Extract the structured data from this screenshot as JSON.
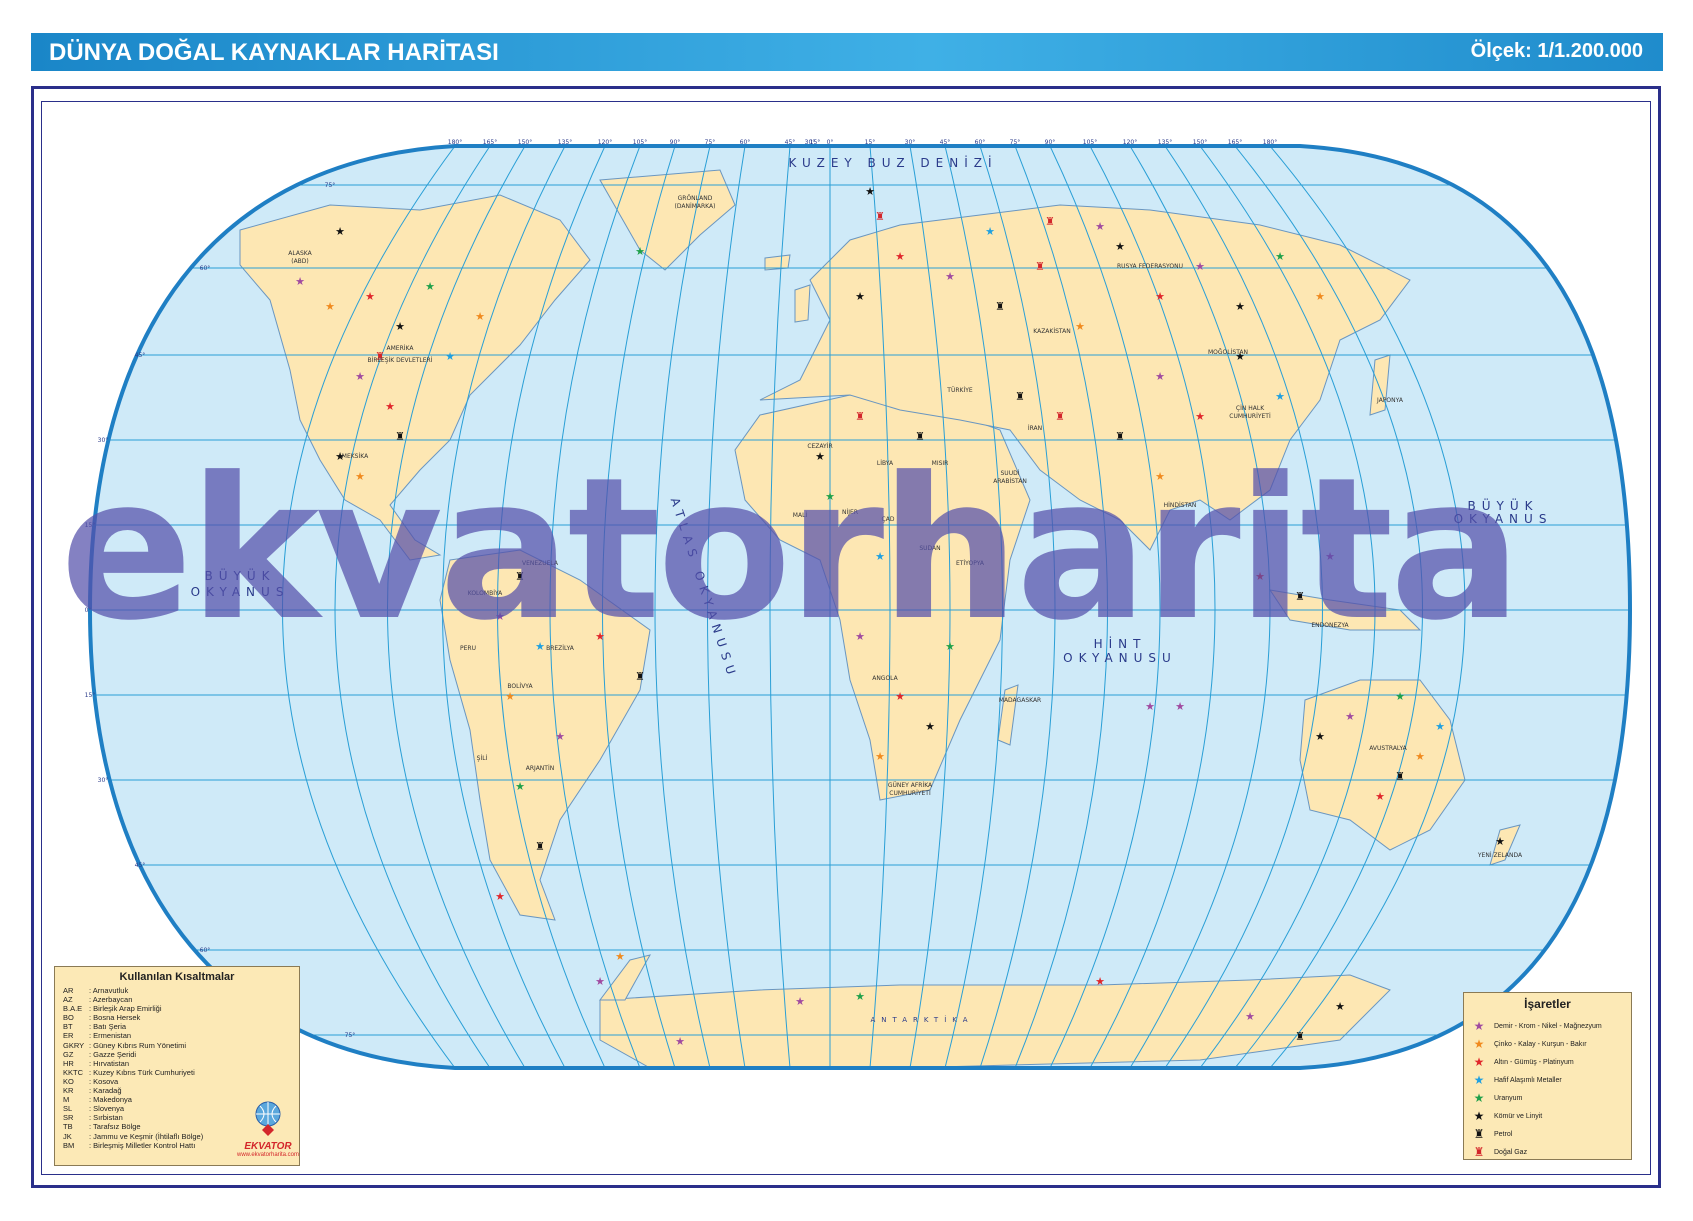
{
  "header": {
    "title": "DÜNYA DOĞAL KAYNAKLAR HARİTASI",
    "scale": "Ölçek: 1/1.200.000"
  },
  "watermark": "ekvatorharita",
  "colors": {
    "ocean": "#cfeaf8",
    "land": "#fde7b3",
    "grid": "#2a9fd6",
    "frame": "#2a2f8a",
    "border": "#1f7fc4"
  },
  "ocean_labels": {
    "arctic": "KUZEY BUZ DENİZİ",
    "atlantic": "ATLAS OKYANUSU",
    "pacific_east": [
      "BÜYÜK",
      "OKYANUS"
    ],
    "pacific_west": [
      "BÜYÜK",
      "OKYANUS"
    ],
    "indian": [
      "HİNT",
      "OKYANUSU"
    ],
    "antarctica": "ANTARKTİKA"
  },
  "country_labels": {
    "greenland": [
      "GRÖNLAND",
      "(DANİMARKA)"
    ],
    "alaska": [
      "ALASKA",
      "(ABD)"
    ],
    "usa": [
      "AMERİKA",
      "BİRLEŞİK DEVLETLERİ"
    ],
    "russia": "RUSYA FEDERASYONU",
    "china": [
      "ÇİN HALK",
      "CUMHURİYETİ"
    ],
    "australia": "AVUSTRALYA",
    "brazil": "BREZİLYA",
    "argentina": "ARJANTİN",
    "mexico": "MEKSİKA",
    "india": "HİNDİSTAN",
    "kazakhstan": "KAZAKİSTAN",
    "mongolia": "MOĞOLİSTAN",
    "libya": "LİBYA",
    "egypt": "MISIR",
    "turkey": "TÜRKİYE",
    "iran": "İRAN",
    "angola": "ANGOLA",
    "colombia": "KOLOMBİYA",
    "peru": "PERU",
    "bolivia": "BOLİVYA",
    "new_zealand": "YENİ ZELANDA",
    "south_africa": [
      "GÜNEY AFRİKA",
      "CUMHURİYETİ"
    ],
    "madagascar": "MADAGASKAR",
    "algeria": "CEZAYİR",
    "mali": "MALİ",
    "niger": "NİJER",
    "chad": "ÇAD",
    "sudan": "SUDAN",
    "ethiopia": "ETİYOPYA",
    "indonesia": "ENDONEZYA",
    "japan": "JAPONYA",
    "venezuela": "VENEZUELA",
    "chile": "ŞİLİ",
    "saudi": [
      "SUUDİ",
      "ARABİSTAN"
    ]
  },
  "graticule": {
    "top_longitudes": [
      "180°",
      "165°",
      "150°",
      "135°",
      "120°",
      "105°",
      "90°",
      "75°",
      "60°",
      "45°",
      "30°",
      "15°",
      "0°",
      "15°",
      "30°",
      "45°",
      "60°",
      "75°",
      "90°",
      "105°",
      "120°",
      "135°",
      "150°",
      "165°",
      "180°"
    ],
    "latitudes_left": [
      "75°",
      "60°",
      "45°",
      "30°",
      "15°",
      "0°",
      "15°",
      "30°",
      "45°",
      "60°",
      "75°"
    ]
  },
  "abbreviations": {
    "title": "Kullanılan Kısaltmalar",
    "items": [
      [
        "AR",
        ": Arnavutluk"
      ],
      [
        "AZ",
        ": Azerbaycan"
      ],
      [
        "B.A.E",
        ": Birleşik Arap Emirliği"
      ],
      [
        "BO",
        ": Bosna Hersek"
      ],
      [
        "BT",
        ": Batı Şeria"
      ],
      [
        "ER",
        ": Ermenistan"
      ],
      [
        "GKRY",
        ": Güney Kıbrıs Rum Yönetimi"
      ],
      [
        "GZ",
        ": Gazze Şeridi"
      ],
      [
        "HR",
        ": Hırvatistan"
      ],
      [
        "KKTC",
        ": Kuzey Kıbrıs Türk Cumhuriyeti"
      ],
      [
        "KO",
        ": Kosova"
      ],
      [
        "KR",
        ": Karadağ"
      ],
      [
        "M",
        ": Makedonya"
      ],
      [
        "SL",
        ": Slovenya"
      ],
      [
        "SR",
        ": Sırbistan"
      ],
      [
        "TB",
        ": Tarafsız Bölge"
      ],
      [
        "JK",
        ": Jammu ve Keşmir (İhtilaflı Bölge)"
      ],
      [
        "BM",
        ": Birleşmiş Milletler Kontrol Hattı"
      ]
    ]
  },
  "legend": {
    "title": "İşaretler",
    "items": [
      {
        "label": "Demir - Krom - Nikel - Mağnezyum",
        "color": "#a04aa0",
        "icon": "star-icon"
      },
      {
        "label": "Çinko - Kalay - Kurşun - Bakır",
        "color": "#f08a1e",
        "icon": "star-icon"
      },
      {
        "label": "Altın - Gümüş - Platinyum",
        "color": "#e0262b",
        "icon": "star-icon"
      },
      {
        "label": "Hafif Alaşımlı Metaller",
        "color": "#1fa0e0",
        "icon": "star-icon"
      },
      {
        "label": "Uranyum",
        "color": "#1fa04a",
        "icon": "star-icon"
      },
      {
        "label": "Kömür ve Linyit",
        "color": "#111111",
        "icon": "star-icon"
      },
      {
        "label": "Petrol",
        "color": "#111111",
        "icon": "oil-derrick-icon"
      },
      {
        "label": "Doğal Gaz",
        "color": "#d3262b",
        "icon": "gas-derrick-icon"
      }
    ]
  },
  "logo": {
    "brand": "EKVATOR",
    "url": "www.ekvatorharita.com"
  }
}
